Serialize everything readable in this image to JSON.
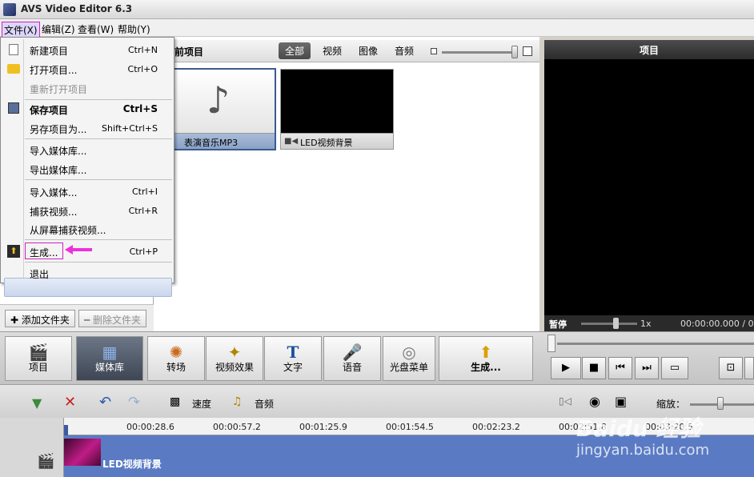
{
  "window": {
    "title": "AVS Video Editor 6.3"
  },
  "menu": [
    {
      "label": "文件(X)",
      "active": true
    },
    {
      "label": "编辑(Z)"
    },
    {
      "label": "查看(W)"
    },
    {
      "label": "帮助(Y)"
    }
  ],
  "file_menu": {
    "items": [
      {
        "label": "新建项目",
        "shortcut": "Ctrl+N",
        "icon": "new-file-icon"
      },
      {
        "label": "打开项目...",
        "shortcut": "Ctrl+O",
        "icon": "folder-icon"
      },
      {
        "label": "重新打开项目",
        "shortcut": "",
        "disabled": true
      },
      {
        "label": "保存项目",
        "shortcut": "Ctrl+S",
        "icon": "save-icon",
        "bold": true
      },
      {
        "label": "另存项目为...",
        "shortcut": "Shift+Ctrl+S"
      },
      {
        "label": "导入媒体库...",
        "shortcut": ""
      },
      {
        "label": "导出媒体库...",
        "shortcut": ""
      },
      {
        "label": "导入媒体...",
        "shortcut": "Ctrl+I"
      },
      {
        "label": "捕获视频...",
        "shortcut": "Ctrl+R"
      },
      {
        "label": "从屏幕捕获视频...",
        "shortcut": ""
      },
      {
        "label": "生成...",
        "shortcut": "Ctrl+P",
        "icon": "produce-icon",
        "highlighted": true
      },
      {
        "label": "退出",
        "shortcut": ""
      }
    ]
  },
  "media_library": {
    "title": "前项目",
    "filters": [
      "全部",
      "视频",
      "图像",
      "音频"
    ],
    "active_filter": "全部",
    "items": [
      {
        "name": "表演音乐MP3",
        "type": "audio"
      },
      {
        "name": "LED视频背景",
        "type": "video"
      }
    ]
  },
  "folder_buttons": {
    "add": "添加文件夹",
    "remove": "删除文件夹"
  },
  "preview": {
    "title": "项目",
    "state": "暂停",
    "speed": "1x",
    "time": "00:00:00.000 / 0"
  },
  "toolbar": [
    {
      "label": "项目",
      "icon": "clapperboard-icon"
    },
    {
      "label": "媒体库",
      "icon": "media-library-icon",
      "selected": true
    },
    {
      "label": "转场",
      "icon": "transition-icon"
    },
    {
      "label": "视频效果",
      "icon": "video-effects-icon"
    },
    {
      "label": "文字",
      "icon": "text-icon"
    },
    {
      "label": "语音",
      "icon": "microphone-icon"
    },
    {
      "label": "光盘菜单",
      "icon": "disc-menu-icon"
    },
    {
      "label": "生成...",
      "icon": "produce-icon"
    }
  ],
  "timeline_toolbar": {
    "speed": "速度",
    "audio": "音频",
    "zoom": "缩放："
  },
  "ruler": [
    "00:00:28.6",
    "00:00:57.2",
    "00:01:25.9",
    "00:01:54.5",
    "00:02:23.2",
    "00:02:51.8",
    "00:03:20.5"
  ],
  "track": {
    "clip_label": "LED视频背景"
  },
  "watermark": {
    "brand": "Baidu 经验",
    "url": "jingyan.baidu.com"
  }
}
